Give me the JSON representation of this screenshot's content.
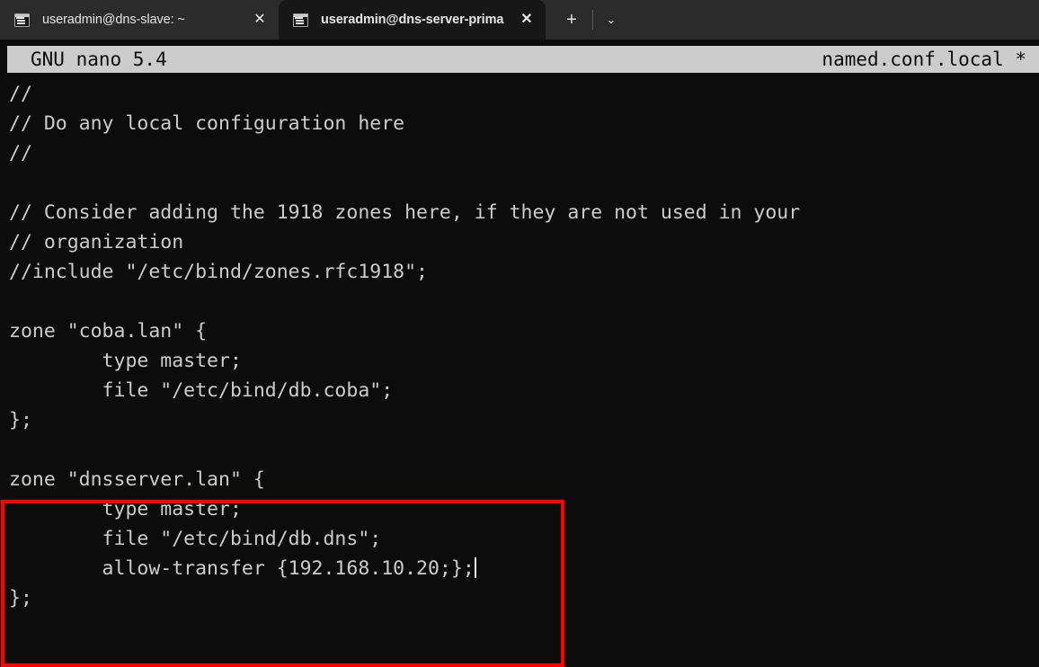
{
  "window": {
    "tabs": [
      {
        "title": "useradmin@dns-slave: ~",
        "icon": "terminal-icon",
        "close_label": "✕",
        "active": false
      },
      {
        "title": "useradmin@dns-server-prima",
        "icon": "terminal-icon",
        "close_label": "✕",
        "active": true
      }
    ],
    "new_tab_label": "+",
    "tab_menu_label": "⌄",
    "colors": {
      "titlebar_bg": "#2b2b2b",
      "active_tab_bg": "#171717",
      "terminal_bg": "#0c0c0c",
      "terminal_fg": "#cccccc",
      "nano_header_bg": "#cccccc",
      "annotation": "#ff0000"
    }
  },
  "nano": {
    "version_label": "GNU nano 5.4",
    "filename": "named.conf.local *",
    "lines": [
      "//",
      "// Do any local configuration here",
      "//",
      "",
      "// Consider adding the 1918 zones here, if they are not used in your",
      "// organization",
      "//include \"/etc/bind/zones.rfc1918\";",
      "",
      "zone \"coba.lan\" {",
      "        type master;",
      "        file \"/etc/bind/db.coba\";",
      "};",
      "",
      "zone \"dnsserver.lan\" {",
      "        type master;",
      "        file \"/etc/bind/db.dns\";",
      "        allow-transfer {192.168.10.20;};",
      "};"
    ],
    "cursor_line_index": 16
  }
}
